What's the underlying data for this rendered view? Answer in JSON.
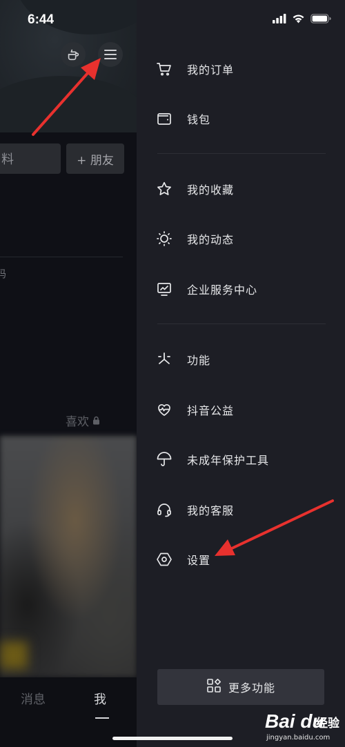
{
  "status_bar": {
    "time": "6:44"
  },
  "profile": {
    "edit_button_fragment": "料",
    "add_friend_label": "+ 朋友",
    "bio_fragment": "码",
    "likes_tab_label": "喜欢"
  },
  "bottom_nav": {
    "messages_label": "消息",
    "me_label": "我"
  },
  "drawer": {
    "items": [
      {
        "label": "我的订单",
        "icon": "cart-icon"
      },
      {
        "label": "钱包",
        "icon": "wallet-icon"
      },
      {
        "label": "我的收藏",
        "icon": "star-icon"
      },
      {
        "label": "我的动态",
        "icon": "sun-icon"
      },
      {
        "label": "企业服务中心",
        "icon": "chart-monitor-icon"
      },
      {
        "label": "功能",
        "icon": "asterisk-icon"
      },
      {
        "label": "抖音公益",
        "icon": "heart-pulse-icon"
      },
      {
        "label": "未成年保护工具",
        "icon": "umbrella-icon"
      },
      {
        "label": "我的客服",
        "icon": "headset-icon"
      },
      {
        "label": "设置",
        "icon": "hexagon-gear-icon"
      }
    ],
    "more_label": "更多功能"
  },
  "watermark": {
    "logo": "Bai du",
    "brand_cn": "经验",
    "url": "jingyan.baidu.com"
  },
  "colors": {
    "drawer_bg": "#1d1e25",
    "arrow": "#e8312e",
    "text": "#e7e8ea"
  }
}
